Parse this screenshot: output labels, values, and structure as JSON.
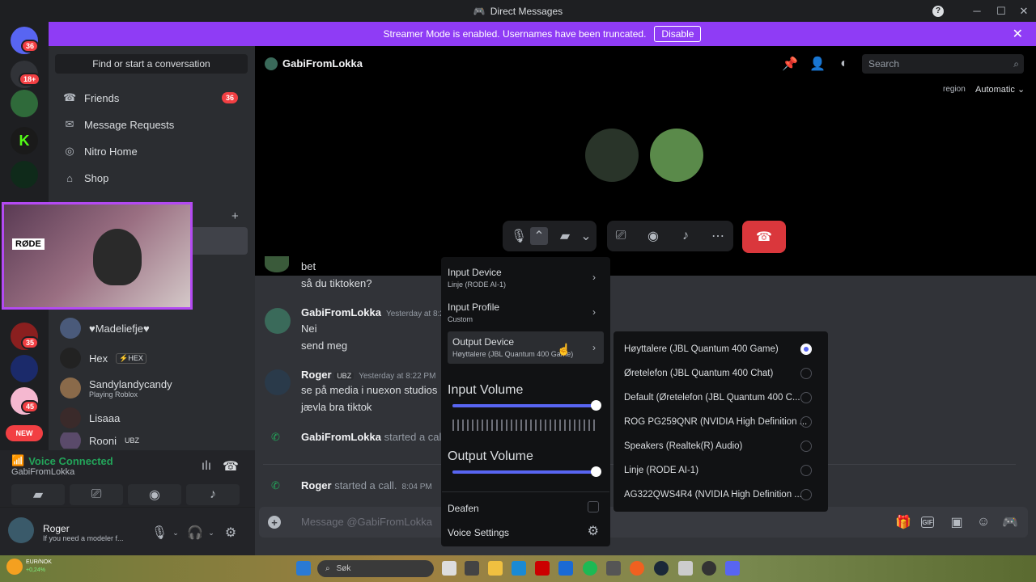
{
  "window": {
    "title": "Direct Messages",
    "help": "?",
    "minimize": "─",
    "maximize": "☐",
    "close": "✕"
  },
  "banner": {
    "text": "Streamer Mode is enabled. Usernames have been truncated.",
    "button": "Disable",
    "close": "✕"
  },
  "rail": {
    "badges": [
      "36",
      "18+",
      "35",
      "45"
    ],
    "new_label": "NEW"
  },
  "sidebar": {
    "search_placeholder": "Find or start a conversation",
    "nav": [
      {
        "label": "Friends",
        "count": "36"
      },
      {
        "label": "Message Requests"
      },
      {
        "label": "Nitro Home"
      },
      {
        "label": "Shop"
      }
    ],
    "add_dm": "+",
    "dms": [
      {
        "name": "♥Madeliefje♥"
      },
      {
        "name": "Hex",
        "tag": "⚡HEX"
      },
      {
        "name": "Sandylandycandy",
        "status": "Playing Roblox"
      },
      {
        "name": "Lisaaa"
      },
      {
        "name": "Rooni",
        "tag": "UBZ"
      }
    ]
  },
  "voice": {
    "status": "Voice Connected",
    "channel": "GabiFromLokka"
  },
  "user": {
    "name": "Roger",
    "status": "If you need a modeler f..."
  },
  "header": {
    "dm_name": "GabiFromLokka",
    "search_placeholder": "Search",
    "region_label": "region",
    "region_value": "Automatic"
  },
  "messages": [
    {
      "lines": [
        "bet",
        "så du tiktoken?"
      ]
    },
    {
      "author": "GabiFromLokka",
      "time": "Yesterday at 8:22",
      "lines": [
        "Nei",
        "send meg"
      ]
    },
    {
      "author": "Roger",
      "tag": "UBZ",
      "time": "Yesterday at 8:22 PM",
      "lines": [
        "se på media i nuexon studios",
        "jævla bra tiktok"
      ]
    },
    {
      "author": "GabiFromLokka",
      "text": "started a call"
    },
    {
      "author": "Roger",
      "text": "started a call.",
      "time": "8:04 PM"
    }
  ],
  "composer": {
    "placeholder": "Message @GabiFromLokka"
  },
  "audio_menu": {
    "input_device": {
      "label": "Input Device",
      "value": "Linje (RODE AI-1)"
    },
    "input_profile": {
      "label": "Input Profile",
      "value": "Custom"
    },
    "output_device": {
      "label": "Output Device",
      "value": "Høyttalere (JBL Quantum 400 Game)"
    },
    "input_volume": {
      "label": "Input Volume",
      "level": 1.0
    },
    "output_volume": {
      "label": "Output Volume",
      "level": 1.0
    },
    "deafen": "Deafen",
    "voice_settings": "Voice Settings"
  },
  "devices": [
    {
      "name": "Høyttalere (JBL Quantum 400 Game)",
      "selected": true
    },
    {
      "name": "Øretelefon (JBL Quantum 400 Chat)",
      "selected": false
    },
    {
      "name": "Default (Øretelefon (JBL Quantum 400 C...",
      "selected": false
    },
    {
      "name": "ROG PG259QNR (NVIDIA High Definition ...",
      "selected": false
    },
    {
      "name": "Speakers (Realtek(R) Audio)",
      "selected": false
    },
    {
      "name": "Linje (RODE AI-1)",
      "selected": false
    },
    {
      "name": "AG322QWS4R4 (NVIDIA High Definition ...",
      "selected": false
    }
  ],
  "webcam": {
    "logo_text": "RØDE"
  },
  "taskbar": {
    "search_placeholder": "Søk",
    "ticker": "EUR/NOK",
    "ticker_change": "+0,24%"
  },
  "colors": {
    "accent": "#5865f2",
    "banner": "#8f3cf5",
    "danger": "#da373c",
    "green": "#23a55a"
  }
}
